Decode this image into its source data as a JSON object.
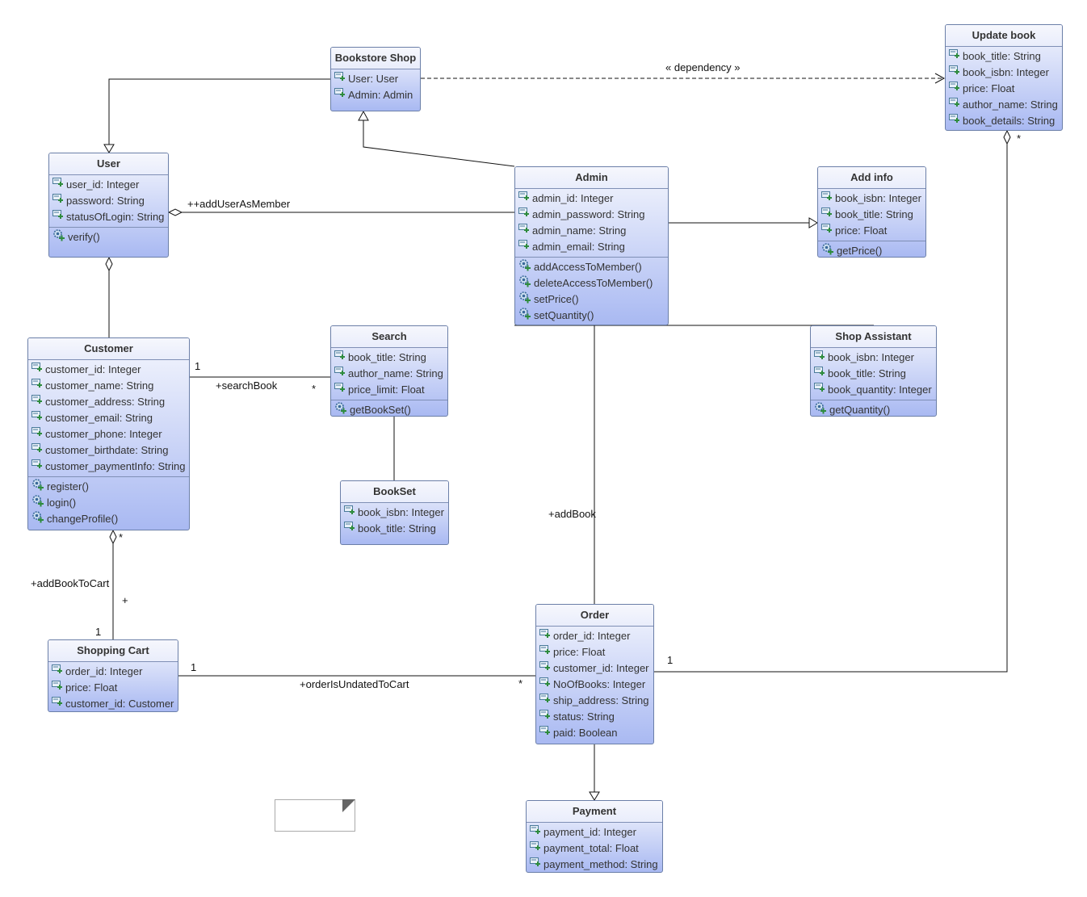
{
  "classes": [
    {
      "id": "bookstore",
      "name": "Bookstore Shop",
      "attributes": [
        "User: User",
        "Admin: Admin"
      ],
      "operations": []
    },
    {
      "id": "update",
      "name": "Update book",
      "attributes": [
        "book_title: String",
        "book_isbn: Integer",
        "price: Float",
        "author_name: String",
        "book_details: String"
      ],
      "operations": []
    },
    {
      "id": "user",
      "name": "User",
      "attributes": [
        "user_id: Integer",
        "password: String",
        "statusOfLogin: String"
      ],
      "operations": [
        "verify()"
      ]
    },
    {
      "id": "admin",
      "name": "Admin",
      "attributes": [
        "admin_id: Integer",
        "admin_password: String",
        "admin_name: String",
        "admin_email: String"
      ],
      "operations": [
        "addAccessToMember()",
        "deleteAccessToMember()",
        "setPrice()",
        "setQuantity()"
      ]
    },
    {
      "id": "addinfo",
      "name": "Add info",
      "attributes": [
        "book_isbn: Integer",
        "book_title: String",
        "price: Float"
      ],
      "operations": [
        "getPrice()"
      ]
    },
    {
      "id": "customer",
      "name": "Customer",
      "attributes": [
        "customer_id: Integer",
        "customer_name: String",
        "customer_address: String",
        "customer_email: String",
        "customer_phone: Integer",
        "customer_birthdate: String",
        "customer_paymentInfo: String"
      ],
      "operations": [
        "register()",
        "login()",
        "changeProfile()"
      ]
    },
    {
      "id": "search",
      "name": "Search",
      "attributes": [
        "book_title: String",
        "author_name: String",
        "price_limit: Float"
      ],
      "operations": [
        "getBookSet()"
      ]
    },
    {
      "id": "shopassistant",
      "name": "Shop Assistant",
      "attributes": [
        "book_isbn: Integer",
        "book_title: String",
        "book_quantity: Integer"
      ],
      "operations": [
        "getQuantity()"
      ]
    },
    {
      "id": "bookset",
      "name": "BookSet",
      "attributes": [
        "book_isbn: Integer",
        "book_title: String"
      ],
      "operations": []
    },
    {
      "id": "cart",
      "name": "Shopping Cart",
      "attributes": [
        "order_id: Integer",
        "price: Float",
        "customer_id: Customer"
      ],
      "operations": []
    },
    {
      "id": "order",
      "name": "Order",
      "attributes": [
        "order_id: Integer",
        "price: Float",
        "customer_id: Integer",
        "NoOfBooks: Integer",
        "ship_address: String",
        "status: String",
        "paid: Boolean"
      ],
      "operations": []
    },
    {
      "id": "payment",
      "name": "Payment",
      "attributes": [
        "payment_id: Integer",
        "payment_total: Float",
        "payment_method: String"
      ],
      "operations": []
    }
  ],
  "labels": {
    "dependency": "« dependency »",
    "addUserAsMember": "++addUserAsMember",
    "searchBook": "+searchBook",
    "searchBook_m1": "1",
    "searchBook_m2": "*",
    "addBook": "+addBook",
    "addBookToCart": "+addBookToCart",
    "addBookToCart_m1": "*",
    "addBookToCart_plus": "+",
    "addBookToCart_m2": "1",
    "orderIsUndatedToCart": "+orderIsUndatedToCart",
    "cart_m1": "1",
    "cart_m2": "*",
    "order_update_m1": "1",
    "order_update_m2": "*"
  },
  "colors": {
    "class_fill_top": "#f4f6fd",
    "class_fill_bottom": "#a9b9f2",
    "class_border": "#6b7fa8",
    "attr_icon": "#2e8b3d"
  }
}
